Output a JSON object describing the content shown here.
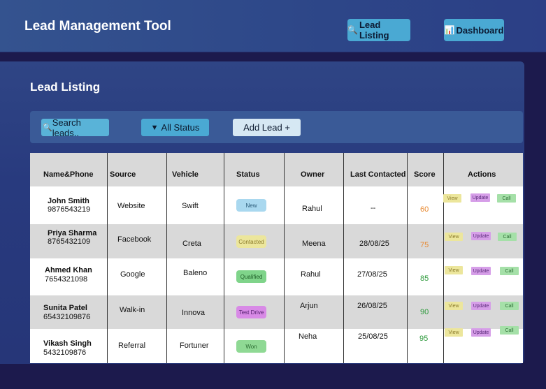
{
  "header": {
    "title": "Lead Management Tool",
    "nav": [
      {
        "label": "Lead Listing",
        "icon": "magnifier-icon"
      },
      {
        "label": "Dashboard",
        "icon": "bar-chart-icon"
      }
    ]
  },
  "page": {
    "title": "Lead Listing"
  },
  "toolbar": {
    "search_label": "Search leads..",
    "status_label": "All Status",
    "add_label": "Add Lead +"
  },
  "table": {
    "columns": [
      "Name&Phone",
      "Source",
      "Vehicle",
      "Status",
      "Owner",
      "Last Contacted",
      "Score",
      "Actions"
    ],
    "rows": [
      {
        "name": "John Smith",
        "phone": "9876543219",
        "source": "Website",
        "vehicle": "Swift",
        "status": "New",
        "owner": "Rahul",
        "last": "--",
        "score": "60"
      },
      {
        "name": "Priya Sharma",
        "phone": "8765432109",
        "source": "Facebook",
        "vehicle": "Creta",
        "status": "Contacted",
        "owner": "Meena",
        "last": "28/08/25",
        "score": "75"
      },
      {
        "name": "Ahmed Khan",
        "phone": "7654321098",
        "source": "Google",
        "vehicle": "Baleno",
        "status": "Qualified",
        "owner": "Rahul",
        "last": "27/08/25",
        "score": "85"
      },
      {
        "name": "Sunita Patel",
        "phone": "65432109876",
        "source": "Walk-in",
        "vehicle": "Innova",
        "status": "Test Drive",
        "owner": "Arjun",
        "last": "26/08/25",
        "score": "90"
      },
      {
        "name": "Vikash Singh",
        "phone": "5432109876",
        "source": "Referral",
        "vehicle": "Fortuner",
        "status": "Won",
        "owner": "Neha",
        "last": "25/08/25",
        "score": "95"
      }
    ],
    "actions": {
      "view": "View",
      "update": "Update",
      "call": "Call"
    }
  },
  "colors": {
    "status_new": "#a9d8ef",
    "status_contacted": "#ece69c",
    "status_qualified": "#7fd48a",
    "status_test_drive": "#d88ae6",
    "status_won": "#8fd994",
    "score_medium": "#e8882f",
    "score_high": "#2e9a3c"
  }
}
